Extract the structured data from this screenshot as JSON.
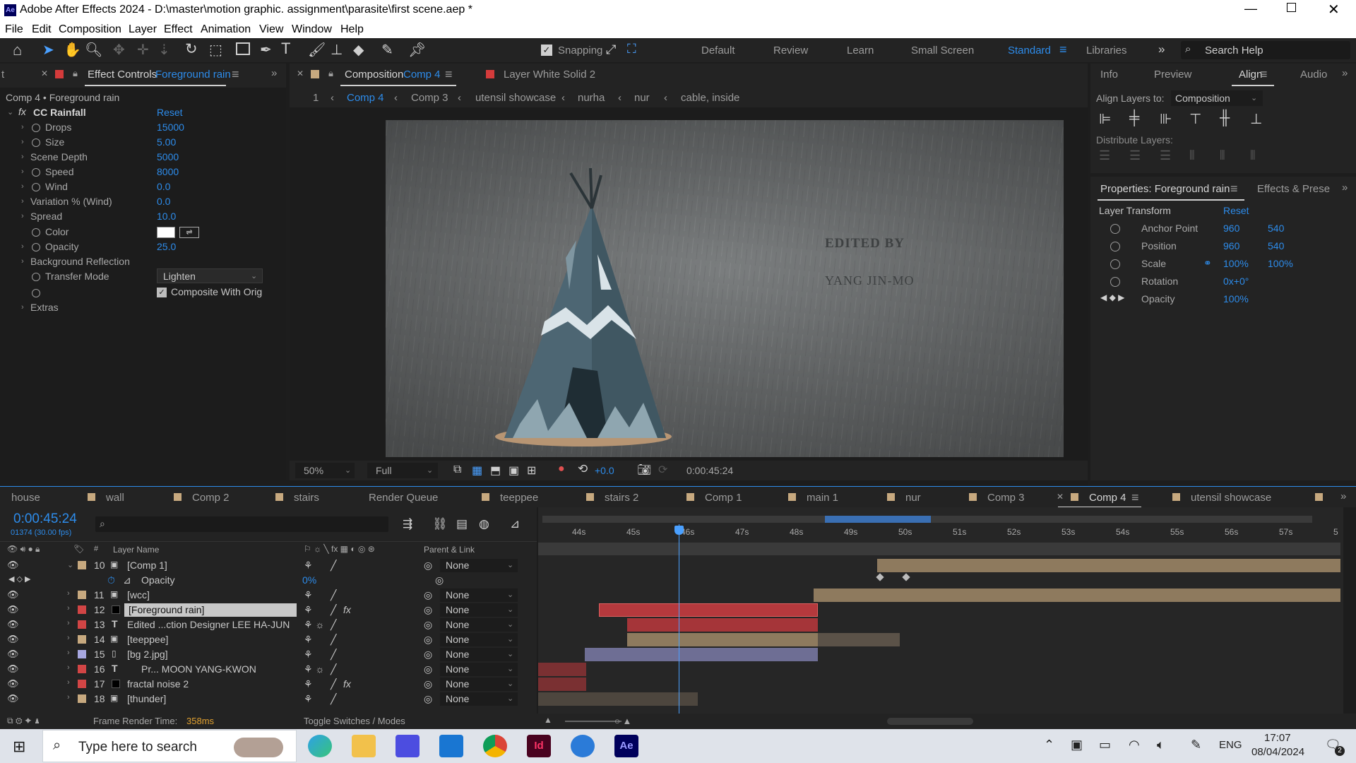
{
  "window": {
    "title": "Adobe After Effects 2024 - D:\\master\\motion graphic. assignment\\parasite\\first scene.aep *",
    "app_badge": "Ae"
  },
  "menu": [
    "File",
    "Edit",
    "Composition",
    "Layer",
    "Effect",
    "Animation",
    "View",
    "Window",
    "Help"
  ],
  "toolbar": {
    "snapping": "Snapping",
    "workspaces": [
      "Default",
      "Review",
      "Learn",
      "Small Screen",
      "Standard",
      "Libraries"
    ],
    "search_placeholder": "Search Help"
  },
  "effect_controls": {
    "tab_prefix": "t",
    "tab_title": "Effect Controls",
    "tab_layer": "Foreground rain",
    "header": "Comp 4 • Foreground rain",
    "effect_name": "CC Rainfall",
    "reset": "Reset",
    "params": [
      {
        "label": "Drops",
        "value": "15000"
      },
      {
        "label": "Size",
        "value": "5.00"
      },
      {
        "label": "Scene Depth",
        "value": "5000"
      },
      {
        "label": "Speed",
        "value": "8000"
      },
      {
        "label": "Wind",
        "value": "0.0"
      },
      {
        "label": "Variation % (Wind)",
        "value": "0.0"
      },
      {
        "label": "Spread",
        "value": "10.0"
      },
      {
        "label": "Color",
        "value": ""
      },
      {
        "label": "Opacity",
        "value": "25.0"
      },
      {
        "label": "Background Reflection",
        "value": ""
      },
      {
        "label": "Transfer Mode",
        "value": "Lighten"
      },
      {
        "label": "",
        "value": "Composite With Orig"
      },
      {
        "label": "Extras",
        "value": ""
      }
    ]
  },
  "composition": {
    "tab_title": "Composition",
    "tab_comp": "Comp 4",
    "layer_tab": "Layer  White Solid 2",
    "breadcrumbs": [
      "1",
      "Comp 4",
      "Comp 3",
      "utensil showcase",
      "nurha",
      "nur",
      "cable, inside"
    ],
    "zoom": "50%",
    "quality": "Full",
    "exposure": "+0.0",
    "timecode": "0:00:45:24",
    "overlay_line1": "EDITED BY",
    "overlay_line2": "YANG JIN-MO"
  },
  "right": {
    "tabs": [
      "Info",
      "Preview",
      "Align",
      "Audio"
    ],
    "align_layers_to": "Align Layers to:",
    "align_target": "Composition",
    "distribute": "Distribute Layers:",
    "props_tab": "Properties: Foreground rain",
    "effects_tab": "Effects & Prese",
    "layer_transform": "Layer Transform",
    "reset": "Reset",
    "props": [
      {
        "label": "Anchor Point",
        "v1": "960",
        "v2": "540"
      },
      {
        "label": "Position",
        "v1": "960",
        "v2": "540"
      },
      {
        "label": "Scale",
        "v1": "100%",
        "v2": "100%"
      },
      {
        "label": "Rotation",
        "v1": "0x+0°",
        "v2": ""
      },
      {
        "label": "Opacity",
        "v1": "100%",
        "v2": ""
      }
    ]
  },
  "timeline": {
    "tabs": [
      "house",
      "wall",
      "Comp 2",
      "stairs",
      "Render Queue",
      "teeppee",
      "stairs 2",
      "Comp 1",
      "main 1",
      "nur",
      "Comp 3",
      "Comp 4",
      "utensil showcase"
    ],
    "timecode": "0:00:45:24",
    "frame_info": "01374 (30.00 fps)",
    "col_layer": "Layer Name",
    "col_parent": "Parent & Link",
    "ruler": [
      "44s",
      "45s",
      "46s",
      "47s",
      "48s",
      "49s",
      "50s",
      "51s",
      "52s",
      "53s",
      "54s",
      "55s",
      "56s",
      "57s",
      "5"
    ],
    "layers": [
      {
        "num": "10",
        "name": "[Comp 1]",
        "parent": "None",
        "color": "#c7a97f"
      },
      {
        "num": "",
        "name": "Opacity",
        "parent": "",
        "value": "0%",
        "color": ""
      },
      {
        "num": "11",
        "name": "[wcc]",
        "parent": "None",
        "color": "#c7a97f"
      },
      {
        "num": "12",
        "name": "[Foreground rain]",
        "parent": "None",
        "color": "#d24545"
      },
      {
        "num": "13",
        "name": "Edited ...ction Designer  LEE HA-JUN",
        "parent": "None",
        "color": "#d24545"
      },
      {
        "num": "14",
        "name": "[teeppee]",
        "parent": "None",
        "color": "#c7a97f"
      },
      {
        "num": "15",
        "name": "[bg 2.jpg]",
        "parent": "None",
        "color": "#a7a7e0"
      },
      {
        "num": "16",
        "name": "Pr...          MOON YANG-KWON",
        "parent": "None",
        "color": "#d24545"
      },
      {
        "num": "17",
        "name": "fractal noise 2",
        "parent": "None",
        "color": "#d24545"
      },
      {
        "num": "18",
        "name": "[thunder]",
        "parent": "None",
        "color": "#c7a97f"
      }
    ],
    "footer_render": "Frame Render Time:",
    "footer_ms": "358ms",
    "footer_toggle": "Toggle Switches / Modes"
  },
  "taskbar": {
    "search": "Type here to search",
    "lang": "ENG",
    "time": "17:07",
    "date": "08/04/2024",
    "notif": "2"
  }
}
